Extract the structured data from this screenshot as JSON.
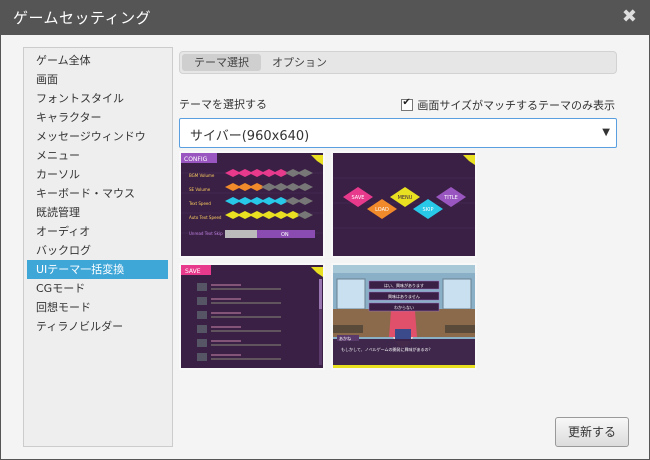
{
  "window": {
    "title": "ゲームセッティング"
  },
  "sidebar": {
    "items": [
      {
        "label": "ゲーム全体"
      },
      {
        "label": "画面"
      },
      {
        "label": "フォントスタイル"
      },
      {
        "label": "キャラクター"
      },
      {
        "label": "メッセージウィンドウ"
      },
      {
        "label": "メニュー"
      },
      {
        "label": "カーソル"
      },
      {
        "label": "キーボード・マウス"
      },
      {
        "label": "既読管理"
      },
      {
        "label": "オーディオ"
      },
      {
        "label": "バックログ"
      },
      {
        "label": "UIテーマ一括変換"
      },
      {
        "label": "CGモード"
      },
      {
        "label": "回想モード"
      },
      {
        "label": "ティラノビルダー"
      }
    ],
    "active_index": 11
  },
  "tabs": [
    {
      "label": "テーマ選択"
    },
    {
      "label": "オプション"
    }
  ],
  "theme": {
    "select_label": "テーマを選択する",
    "checkbox_label": "画面サイズがマッチするテーマのみ表示",
    "checkbox_checked": true,
    "selected": "サイバー(960x640)"
  },
  "previews": {
    "config": {
      "tag": "CONFIG",
      "rows": [
        "BGM Volume",
        "SE Volume",
        "Text Speed",
        "Auto Text Speed",
        "Unread Text Skip"
      ],
      "toggle": "ON"
    },
    "menu": {
      "buttons": [
        "SAVE",
        "LOAD",
        "MENU",
        "TITLE",
        "SKIP"
      ]
    },
    "save": {
      "tag": "SAVE"
    },
    "game": {
      "name": "あかね",
      "dialog": "もしかして、ノベルゲームの開発に興味があるの？",
      "choices": [
        "はい、興味があります",
        "興味はありません",
        "わからない"
      ]
    }
  },
  "footer": {
    "update_label": "更新する"
  },
  "colors": {
    "accent": "#3fa6d8",
    "titlebar": "#555555",
    "cyber_bg": "#3a2045",
    "pink": "#e83a8c",
    "orange": "#f08a2a",
    "cyan": "#28c8e8",
    "yellow": "#e8e020"
  }
}
